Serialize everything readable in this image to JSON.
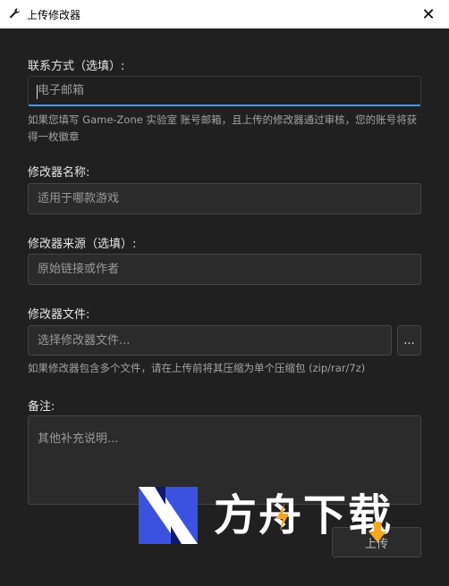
{
  "window": {
    "title": "上传修改器",
    "close_glyph": "✕"
  },
  "form": {
    "contact": {
      "label": "联系方式（选填）:",
      "placeholder": "电子邮箱",
      "help": "如果您填写 Game-Zone 实验室 账号邮箱，且上传的修改器通过审核，您的账号将获得一枚徽章"
    },
    "name": {
      "label": "修改器名称:",
      "placeholder": "适用于哪款游戏"
    },
    "source": {
      "label": "修改器来源（选填）:",
      "placeholder": "原始链接或作者"
    },
    "file": {
      "label": "修改器文件:",
      "placeholder": "选择修改器文件...",
      "browse_label": "...",
      "help": "如果修改器包含多个文件，请在上传前将其压缩为单个压缩包 (zip/rar/7z)"
    },
    "notes": {
      "label": "备注:",
      "placeholder": "其他补充说明..."
    },
    "upload_label": "上传"
  },
  "watermark": {
    "text": "方舟下载"
  },
  "colors": {
    "background": "#202020",
    "field_bg": "#2b2b2b",
    "field_border": "#454545",
    "focus_accent": "#4a9bd6",
    "watermark_bolt": "#f5a623",
    "watermark_logo": "#3b52e0"
  }
}
